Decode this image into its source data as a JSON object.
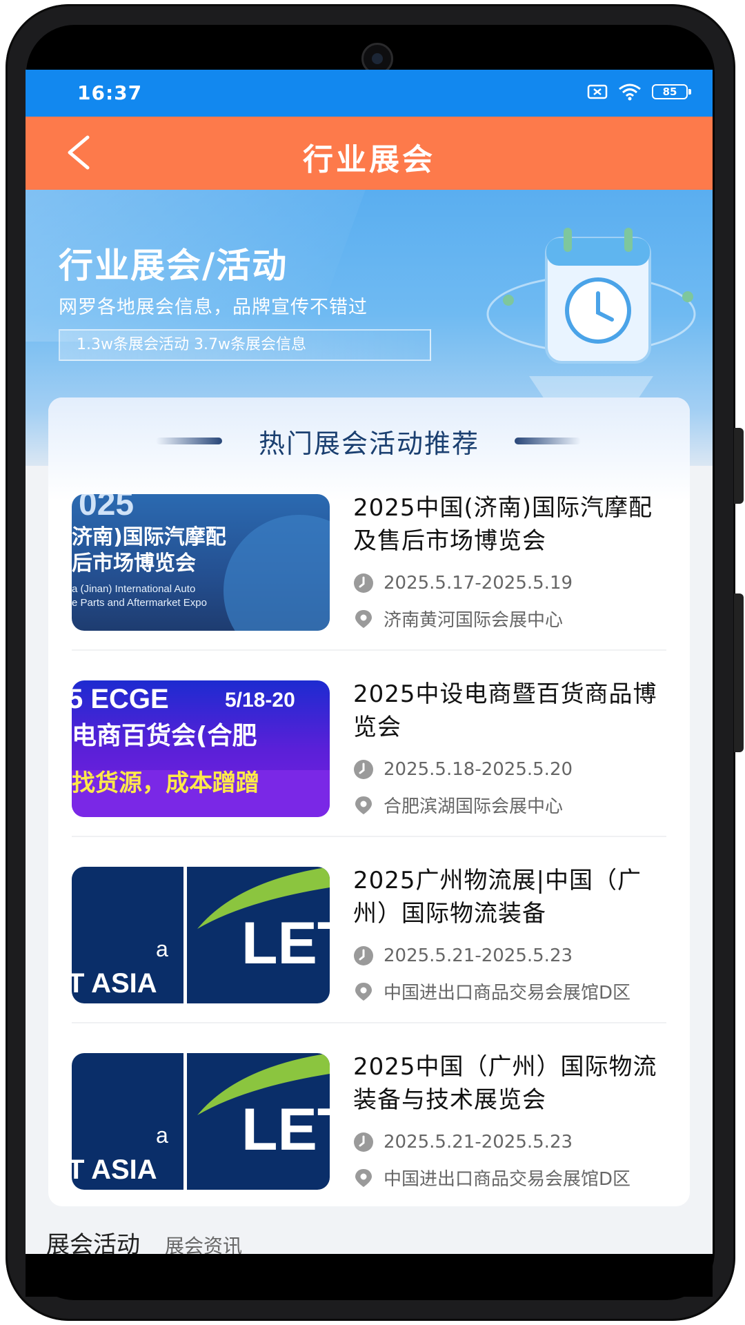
{
  "status_bar": {
    "time": "16:37",
    "battery": "85"
  },
  "app_bar": {
    "title": "行业展会"
  },
  "banner": {
    "title": "行业展会/活动",
    "subtitle": "网罗各地展会信息，品牌宣传不错过",
    "stats": "1.3w条展会活动 3.7w条展会信息"
  },
  "section": {
    "title": "热门展会活动推荐"
  },
  "events": [
    {
      "name": "2025中国(济南)国际汽摩配及售后市场博览会",
      "date": "2025.5.17-2025.5.19",
      "venue": "济南黄河国际会展中心",
      "thumb_lines": [
        "025",
        "济南)国际汽摩配",
        "后市场博览会",
        "a (Jinan) International Auto",
        "e Parts and Aftermarket Expo"
      ]
    },
    {
      "name": "2025中设电商暨百货商品博览会",
      "date": "2025.5.18-2025.5.20",
      "venue": "合肥滨湖国际会展中心",
      "thumb_lines": [
        "5 ECGE",
        "5/18-20",
        "电商百货会(合肥",
        "找货源，成本蹭蹭"
      ]
    },
    {
      "name": "2025广州物流展|中国（广州）国际物流装备",
      "date": "2025.5.21-2025.5.23",
      "venue": "中国进出口商品交易会展馆D区",
      "thumb_lines": [
        "a",
        "T ASIA",
        "LET"
      ]
    },
    {
      "name": "2025中国（广州）国际物流装备与技术展览会",
      "date": "2025.5.21-2025.5.23",
      "venue": "中国进出口商品交易会展馆D区",
      "thumb_lines": [
        "a",
        "T ASIA",
        "LET"
      ]
    }
  ],
  "tabs": {
    "active": "展会活动",
    "inactive": "展会资讯"
  },
  "colors": {
    "status_bar": "#1288ef",
    "app_bar": "#fd7a4b",
    "section_title": "#1a3f70"
  }
}
